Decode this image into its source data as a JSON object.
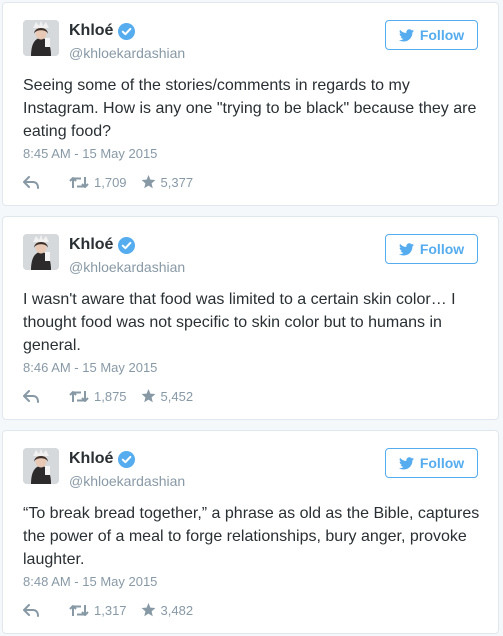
{
  "colors": {
    "accent": "#55acee",
    "muted": "#8899a6",
    "text": "#292f33",
    "border": "#e1e8ed",
    "verified": "#55acee"
  },
  "tweets": [
    {
      "name": "Khloé",
      "handle": "@khloekardashian",
      "follow_label": "Follow",
      "text": "Seeing some of the stories/comments in regards to my Instagram. How is any one \"trying to be black\" because they are eating food?",
      "time": "8:45 AM - 15 May 2015",
      "retweets": "1,709",
      "favorites": "5,377"
    },
    {
      "name": "Khloé",
      "handle": "@khloekardashian",
      "follow_label": "Follow",
      "text": "I wasn't aware that food was limited to a certain skin color… I thought food was not specific to skin color but to humans in general.",
      "time": "8:46 AM - 15 May 2015",
      "retweets": "1,875",
      "favorites": "5,452"
    },
    {
      "name": "Khloé",
      "handle": "@khloekardashian",
      "follow_label": "Follow",
      "text": "“To break bread together,” a phrase as old as the Bible, captures the power of a meal to forge relationships, bury anger, provoke laughter.",
      "time": "8:48 AM - 15 May 2015",
      "retweets": "1,317",
      "favorites": "3,482"
    }
  ]
}
